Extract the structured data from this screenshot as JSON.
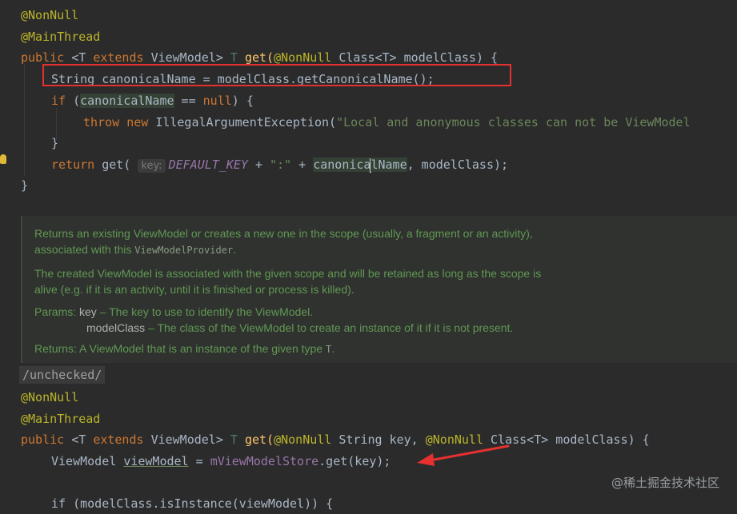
{
  "code_top": {
    "l1": "@NonNull",
    "l2": "@MainThread",
    "l3": {
      "public": "public",
      "T1": "<T",
      "extends": "extends",
      "vm": "ViewModel>",
      "T2": "T",
      "get": "get(",
      "nn": "@NonNull",
      "cls": "Class<T> modelClass) {"
    },
    "l4": "String canonicalName = modelClass.getCanonicalName();",
    "l5": {
      "if": "if",
      "rest1": " (",
      "var": "canonicalName",
      "eq": " == ",
      "null": "null",
      "rest2": ") {"
    },
    "l6": {
      "throw": "throw",
      "new": "new",
      "exc": "IllegalArgumentException(",
      "str": "\"Local and anonymous classes can not be ViewModel"
    },
    "l7": "}",
    "l8": {
      "return": "return",
      "get": "get(",
      "hint": "key:",
      "key": "DEFAULT_KEY",
      "plus1": " + ",
      "colon": "\":\"",
      "plus2": " + ",
      "cn1": "canonica",
      "cn2": "lName",
      "tail": ", modelClass);"
    },
    "l9": "}"
  },
  "doc": {
    "p1a": "Returns an existing ViewModel or creates a new one in the scope (usually, a fragment or an activity),",
    "p1b": "associated with this ",
    "p1c": "ViewModelProvider",
    "p1d": ".",
    "p2a": "The created ViewModel is associated with the given scope and will be retained as long as the scope is",
    "p2b": "alive (e.g. if it is an activity, until it is finished or process is killed).",
    "params_label": "Params:",
    "param1_name": "key",
    "param1_desc": " – The key to use to identify the ViewModel.",
    "param2_name": "modelClass",
    "param2_desc": " – The class of the ViewModel to create an instance of it if it is not present.",
    "returns_label": "Returns:",
    "returns_desc": " A ViewModel that is an instance of the given type ",
    "returns_type": "T",
    "returns_end": "."
  },
  "code_bottom": {
    "l1": "/unchecked/",
    "l2": "@NonNull",
    "l3": "@MainThread",
    "l4": {
      "public": "public",
      "T1": "<T",
      "extends": "extends",
      "vm": "ViewModel>",
      "T2": "T",
      "get": "get(",
      "nn1": "@NonNull",
      "str": "String key,",
      "nn2": "@NonNull",
      "cls": "Class<T> modelClass) {"
    },
    "l5": {
      "type": "ViewModel",
      "var": "viewModel",
      "eq": " = ",
      "field": "mViewModelStore",
      "call": ".get(key);"
    },
    "l6": "if (modelClass.isInstance(viewModel)) {"
  },
  "watermark": "@稀土掘金技术社区"
}
